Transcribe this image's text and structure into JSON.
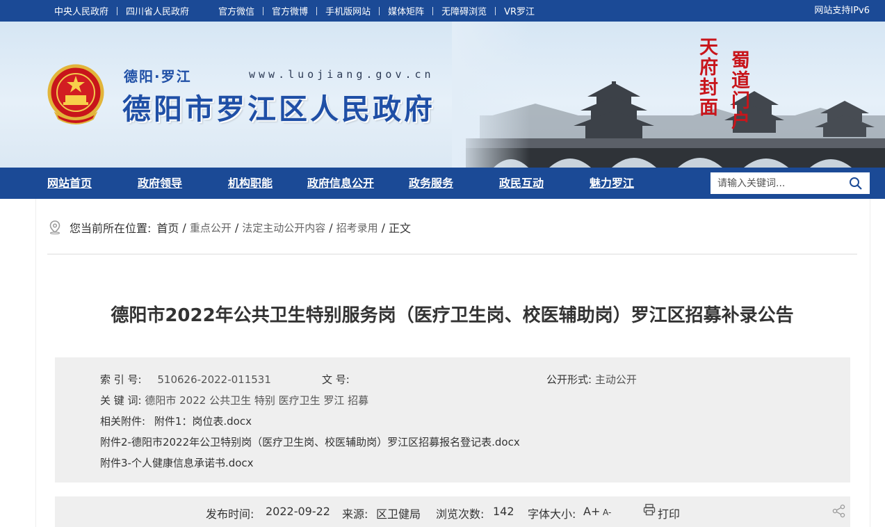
{
  "topbar": {
    "links": [
      "中央人民政府",
      "四川省人民政府",
      "官方微信",
      "官方微博",
      "手机版网站",
      "媒体矩阵",
      "无障碍浏览",
      "VR罗江"
    ],
    "ipv6": "网站支持IPv6"
  },
  "banner": {
    "small_title": "德阳·罗江",
    "url": "www.luojiang.gov.cn",
    "site_title": "德阳市罗江区人民政府",
    "calligraphy_1": "天府封面",
    "calligraphy_2": "蜀道门户"
  },
  "nav": {
    "items": [
      "网站首页",
      "政府领导",
      "机构职能",
      "政府信息公开",
      "政务服务",
      "政民互动",
      "魅力罗江"
    ],
    "search_placeholder": "请输入关键词..."
  },
  "breadcrumb": {
    "prefix": "您当前所在位置:",
    "items": [
      "首页",
      "重点公开",
      "法定主动公开内容",
      "招考录用",
      "正文"
    ]
  },
  "article": {
    "title": "德阳市2022年公共卫生特别服务岗（医疗卫生岗、校医辅助岗）罗江区招募补录公告"
  },
  "meta": {
    "index_label": "索 引 号:",
    "index_value": "510626-2022-011531",
    "doc_label": "文 号:",
    "doc_value": "",
    "form_label": "公开形式:",
    "form_value": "主动公开",
    "keywords_label": "关 键 词:",
    "keywords_value": "德阳市 2022 公共卫生 特别 医疗卫生 罗江 招募",
    "attach_label": "相关附件:",
    "attachments": [
      "附件1：岗位表.docx",
      "附件2-德阳市2022年公卫特别岗（医疗卫生岗、校医辅助岗）罗江区招募报名登记表.docx",
      "附件3-个人健康信息承诺书.docx"
    ]
  },
  "info": {
    "date_label": "发布时间:",
    "date_value": "2022-09-22",
    "source_label": "来源:",
    "source_value": "区卫健局",
    "views_label": "浏览次数:",
    "views_value": "142",
    "font_label": "字体大小:",
    "font_plus": "A+",
    "font_minus": "A-",
    "print_label": "打印"
  },
  "colors": {
    "nav_blue": "#1b4a96",
    "title_blue": "#1f4fa6",
    "calligraphy_red": "#c8151b",
    "meta_bg": "#efefef"
  }
}
